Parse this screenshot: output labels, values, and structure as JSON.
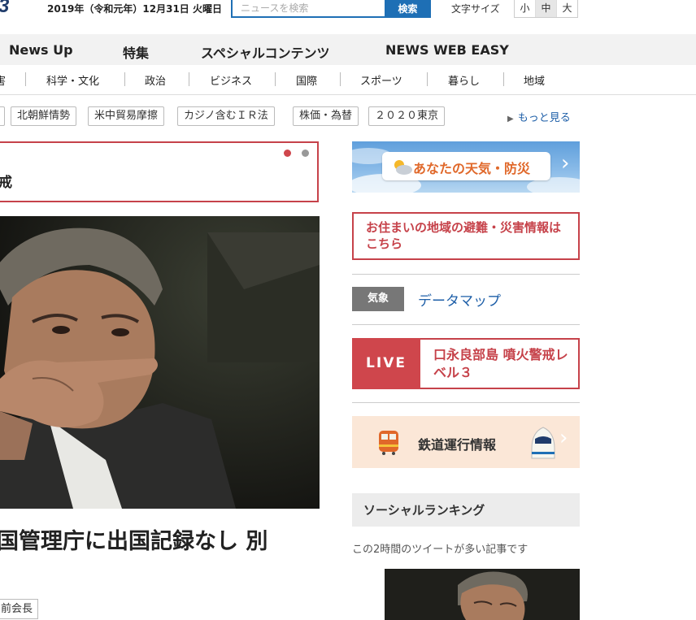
{
  "header": {
    "logo_fragment": "3",
    "date": "2019年（令和元年）12月31日 火曜日",
    "search": {
      "placeholder": "ニュースを検索",
      "button_label": "検索"
    },
    "font_size": {
      "label": "文字サイズ",
      "options": [
        "小",
        "中",
        "大"
      ],
      "selected": "中"
    }
  },
  "nav": {
    "items": [
      "News Up",
      "特集",
      "スペシャルコンテンツ",
      "NEWS WEB EASY"
    ]
  },
  "categories": [
    "害",
    "科学・文化",
    "政治",
    "ビジネス",
    "国際",
    "スポーツ",
    "暮らし",
    "地域"
  ],
  "tags": [
    "北朝鮮情勢",
    "米中貿易摩擦",
    "カジノ含むＩＲ法",
    "株価・為替",
    "２０２０東京"
  ],
  "more_link": "もっと見る",
  "main_article": {
    "headline_fragment": "戒",
    "title": "国管理庁に出国記録なし 別",
    "person_tag": "前会長",
    "carousel": {
      "dots": 2,
      "active": 1
    }
  },
  "sidebar": {
    "weather_banner": "あなたの天気・防災",
    "evacuation_link": "お住まいの地域の避難・災害情報はこちら",
    "weather_tag": "気象",
    "datamap_link": "データマップ",
    "live": {
      "badge": "LIVE",
      "text": "口永良部島 噴火警戒レベル３"
    },
    "rail_banner": "鉄道運行情報",
    "ranking": {
      "title": "ソーシャルランキング",
      "description": "この2時間のツイートが多い記事です"
    }
  },
  "colors": {
    "accent_red": "#c6424a",
    "link_blue": "#1e5fa8",
    "search_blue": "#1e6fb5",
    "weather_orange": "#e0682a"
  }
}
